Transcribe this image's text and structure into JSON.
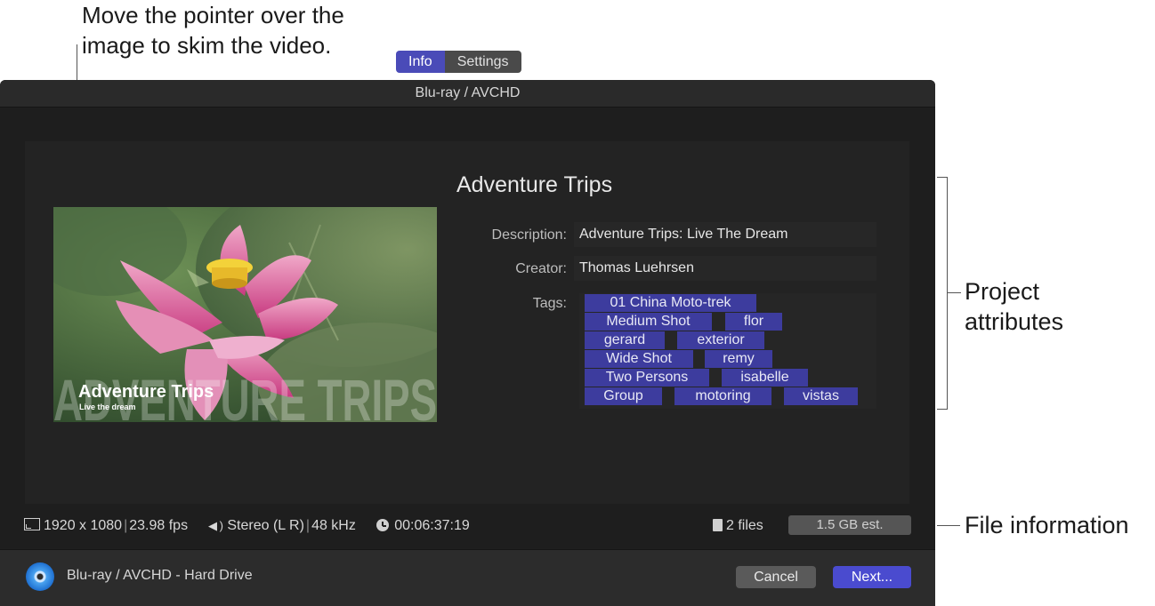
{
  "callouts": {
    "skim_line1": "Move the pointer over the",
    "skim_line2": "image to skim the video.",
    "project_line1": "Project",
    "project_line2": "attributes",
    "file_info": "File information"
  },
  "window": {
    "title": "Blu-ray / AVCHD"
  },
  "tabs": [
    {
      "label": "Info",
      "active": true
    },
    {
      "label": "Settings",
      "active": false
    }
  ],
  "preview": {
    "overlay_title": "Adventure Trips",
    "overlay_subtitle": "Live the dream",
    "watermark": "ADVENTURE TRIPS"
  },
  "project": {
    "title": "Adventure Trips",
    "description_label": "Description:",
    "description": "Adventure Trips: Live The Dream",
    "creator_label": "Creator:",
    "creator": "Thomas Luehrsen",
    "tags_label": "Tags:",
    "tags": [
      "01 China Moto-trek",
      "Medium Shot",
      "flor",
      "gerard",
      "exterior",
      "Wide Shot",
      "remy",
      "Two Persons",
      "isabelle",
      "Group",
      "motoring",
      "vistas"
    ]
  },
  "file_stats": {
    "resolution": "1920 x 1080",
    "fps": "23.98 fps",
    "audio": "Stereo (L R)",
    "sample_rate": "48 kHz",
    "duration": "00:06:37:19",
    "files": "2 files",
    "size_est": "1.5 GB est."
  },
  "footer": {
    "destination": "Blu-ray / AVCHD - Hard Drive",
    "cancel_label": "Cancel",
    "next_label": "Next..."
  },
  "colors": {
    "accent": "#4a4bcf",
    "tag_bg": "#3d3c9e",
    "dialog_bg": "#1f1f1f"
  },
  "icons": [
    "disc-icon",
    "speaker-icon",
    "clock-icon",
    "document-icon",
    "frame-size-icon"
  ]
}
